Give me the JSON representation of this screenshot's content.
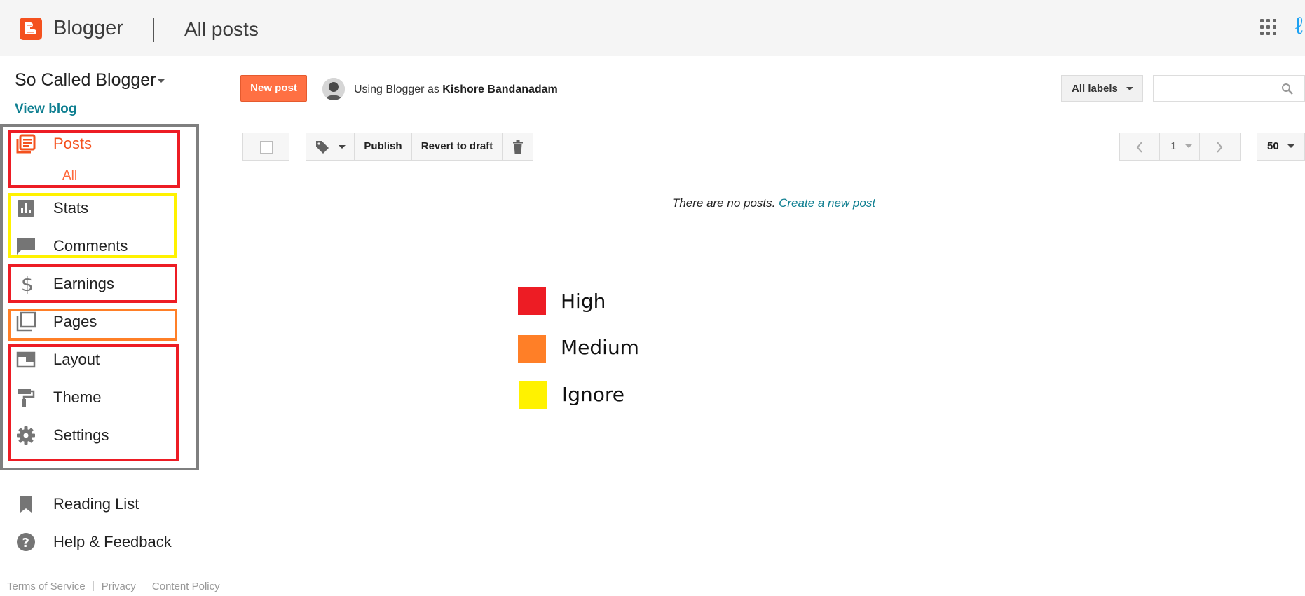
{
  "app": {
    "brand": "Blogger",
    "page_title": "All posts"
  },
  "sidebar": {
    "blog_name": "So Called Blogger",
    "view_blog": "View blog",
    "items": [
      {
        "label": "Posts",
        "icon": "posts-icon",
        "active": true
      },
      {
        "label": "Stats",
        "icon": "stats-icon"
      },
      {
        "label": "Comments",
        "icon": "comment-icon"
      },
      {
        "label": "Earnings",
        "icon": "dollar-icon"
      },
      {
        "label": "Pages",
        "icon": "pages-icon"
      },
      {
        "label": "Layout",
        "icon": "layout-icon"
      },
      {
        "label": "Theme",
        "icon": "paint-roller-icon"
      },
      {
        "label": "Settings",
        "icon": "gear-icon"
      }
    ],
    "sub_item": "All",
    "secondary": [
      {
        "label": "Reading List",
        "icon": "bookmark-icon"
      },
      {
        "label": "Help & Feedback",
        "icon": "help-icon"
      }
    ],
    "footer": [
      "Terms of Service",
      "Privacy",
      "Content Policy"
    ]
  },
  "toolbar": {
    "new_post": "New post",
    "using_prefix": "Using Blogger as",
    "user_name": "Kishore Bandanadam",
    "labels": "All labels",
    "search_placeholder": "",
    "publish": "Publish",
    "revert": "Revert to draft",
    "page_number": "1",
    "per_page": "50"
  },
  "content": {
    "empty_text": "There are no posts.",
    "create_link": "Create a new post"
  },
  "legend": [
    {
      "label": "High",
      "color": "#ed1c24"
    },
    {
      "label": "Medium",
      "color": "#ff7f27"
    },
    {
      "label": "Ignore",
      "color": "#fff200"
    }
  ],
  "colors": {
    "accent": "#f4511e",
    "link": "#0f7f91",
    "highlight_gray": "#7f7f7f"
  }
}
